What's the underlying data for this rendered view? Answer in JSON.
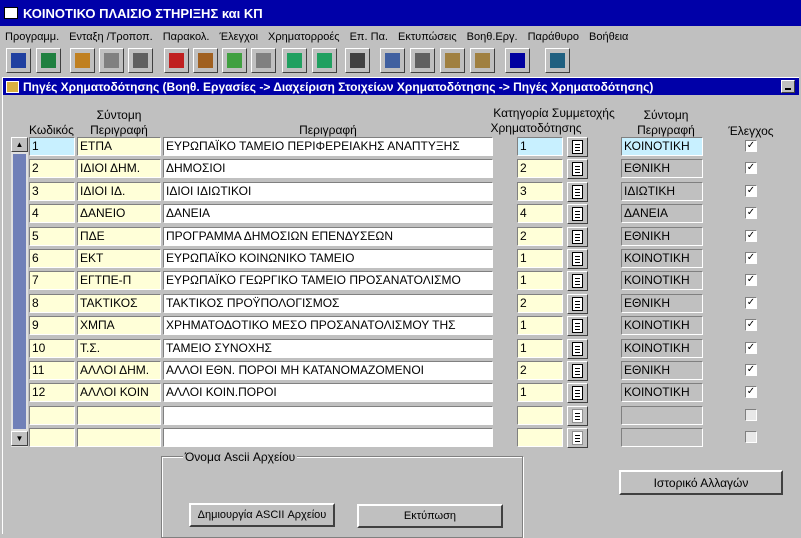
{
  "app": {
    "title": "ΚΟΙΝΟΤΙΚΟ ΠΛΑΙΣΙΟ ΣΤΗΡΙΞΗΣ και ΚΠ"
  },
  "menu": [
    "Προγραμμ.",
    "Ενταξη /Τροποπ.",
    "Παρακολ.",
    "Έλεγχοι",
    "Χρηματορροές",
    "Επ. Πα.",
    "Εκτυπώσεις",
    "Βοηθ.Εργ.",
    "Παράθυρο",
    "Βοήθεια"
  ],
  "toolbar_icons": [
    "save-icon",
    "accept-icon",
    "query-icon",
    "clear-icon",
    "calculator-icon",
    "delete-record-icon",
    "edit-icon",
    "insert-record-icon",
    "remove-record-icon",
    "arrow-up-icon",
    "arrow-down-icon",
    "print-icon",
    "list-icon",
    "report-icon",
    "copy-icon",
    "paste-icon",
    "help-icon",
    "exit-icon"
  ],
  "window": {
    "title": "Πηγές Χρηματοδότησης (Βοηθ. Εργασίες -> Διαχείριση Στοιχείων Χρηματοδότησης -> Πηγές Χρηματοδότησης)"
  },
  "headers": {
    "code": "Κωδικός",
    "short_desc_1": "Σύντομη",
    "short_desc_2": "Περιγραφή",
    "desc": "Περιγραφή",
    "category_1": "Κατηγορία Συμμετοχής",
    "category_2": "Χρηματοδότησης",
    "cat_short_1": "Σύντομη",
    "cat_short_2": "Περιγραφή",
    "check": "Έλεγχος"
  },
  "rows": [
    {
      "code": "1",
      "short": "ΕΤΠΑ",
      "desc": "ΕΥΡΩΠΑΪΚΟ ΤΑΜΕΙΟ ΠΕΡΙΦΕΡΕΙΑΚΗΣ ΑΝΑΠΤΥΞΗΣ",
      "cat": "1",
      "cat_short": "ΚΟΙΝΟΤΙΚΗ",
      "check": "✓"
    },
    {
      "code": "2",
      "short": "ΙΔΙΟΙ ΔΗΜ.",
      "desc": "ΔΗΜΟΣΙΟΙ",
      "cat": "2",
      "cat_short": "ΕΘΝΙΚΗ",
      "check": "✓"
    },
    {
      "code": "3",
      "short": "ΙΔΙΟΙ ΙΔ.",
      "desc": "ΙΔΙΟΙ ΙΔΙΩΤΙΚΟΙ",
      "cat": "3",
      "cat_short": "ΙΔΙΩΤΙΚΗ",
      "check": "✓"
    },
    {
      "code": "4",
      "short": "ΔΑΝΕΙΟ",
      "desc": "ΔΑΝΕΙΑ",
      "cat": "4",
      "cat_short": "ΔΑΝΕΙΑ",
      "check": "✓"
    },
    {
      "code": "5",
      "short": "ΠΔΕ",
      "desc": "ΠΡΟΓΡΑΜΜΑ ΔΗΜΟΣΙΩΝ ΕΠΕΝΔΥΣΕΩΝ",
      "cat": "2",
      "cat_short": "ΕΘΝΙΚΗ",
      "check": "✓"
    },
    {
      "code": "6",
      "short": "ΕΚΤ",
      "desc": "ΕΥΡΩΠΑΪΚΟ ΚΟΙΝΩΝΙΚΟ ΤΑΜΕΙΟ",
      "cat": "1",
      "cat_short": "ΚΟΙΝΟΤΙΚΗ",
      "check": "✓"
    },
    {
      "code": "7",
      "short": "ΕΓΤΠΕ-Π",
      "desc": "ΕΥΡΩΠΑΪΚΟ ΓΕΩΡΓΙΚΟ ΤΑΜΕΙΟ ΠΡΟΣΑΝΑΤΟΛΙΣΜΟ",
      "cat": "1",
      "cat_short": "ΚΟΙΝΟΤΙΚΗ",
      "check": "✓"
    },
    {
      "code": "8",
      "short": "ΤΑΚΤΙΚΟΣ",
      "desc": "ΤΑΚΤΙΚΟΣ ΠΡΟΫΠΟΛΟΓΙΣΜΟΣ",
      "cat": "2",
      "cat_short": "ΕΘΝΙΚΗ",
      "check": "✓"
    },
    {
      "code": "9",
      "short": "ΧΜΠΑ",
      "desc": "ΧΡΗΜΑΤΟΔΟΤΙΚΟ ΜΕΣΟ ΠΡΟΣΑΝΑΤΟΛΙΣΜΟΥ ΤΗΣ",
      "cat": "1",
      "cat_short": "ΚΟΙΝΟΤΙΚΗ",
      "check": "✓"
    },
    {
      "code": "10",
      "short": "Τ.Σ.",
      "desc": "ΤΑΜΕΙΟ ΣΥΝΟΧΗΣ",
      "cat": "1",
      "cat_short": "ΚΟΙΝΟΤΙΚΗ",
      "check": "✓"
    },
    {
      "code": "11",
      "short": "ΑΛΛΟΙ ΔΗΜ.",
      "desc": "ΑΛΛΟΙ ΕΘΝ. ΠΟΡΟΙ ΜΗ ΚΑΤΑΝΟΜΑΖΟΜΕΝΟΙ",
      "cat": "2",
      "cat_short": "ΕΘΝΙΚΗ",
      "check": "✓"
    },
    {
      "code": "12",
      "short": "ΑΛΛΟΙ ΚΟΙΝ",
      "desc": "ΑΛΛΟΙ ΚΟΙΝ.ΠΟΡΟΙ",
      "cat": "1",
      "cat_short": "ΚΟΙΝΟΤΙΚΗ",
      "check": "✓"
    },
    {
      "code": "",
      "short": "",
      "desc": "",
      "cat": "",
      "cat_short": "",
      "check": ""
    },
    {
      "code": "",
      "short": "",
      "desc": "",
      "cat": "",
      "cat_short": "",
      "check": ""
    }
  ],
  "ascii_group": {
    "label": "Όνομα Ascii Αρχείου"
  },
  "buttons": {
    "create_ascii": "Δημιουργία  ASCII Αρχείου",
    "print": "Εκτύπωση",
    "history": "Ιστορικό Αλλαγών"
  },
  "scroll": {
    "up": "▲",
    "down": "▼"
  }
}
